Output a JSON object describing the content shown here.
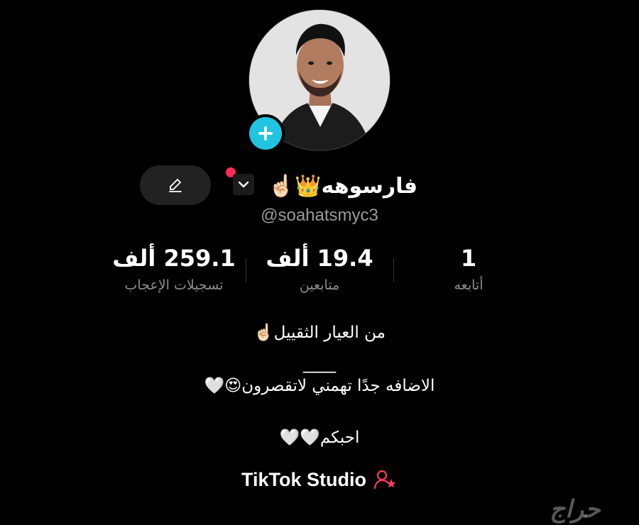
{
  "profile": {
    "display_name": "فارسوهه",
    "name_emojis": "👑☝🏻",
    "handle": "@soahatsmyc3",
    "edit_icon": "pencil-icon",
    "add_icon": "plus-icon",
    "switch_icon": "chevron-down-icon"
  },
  "stats": {
    "likes": {
      "value": "259.1 ألف",
      "label": "تسجيلات الإعجاب"
    },
    "followers": {
      "value": "19.4 ألف",
      "label": "متابعين"
    },
    "following": {
      "value": "1",
      "label": "أتابعه"
    }
  },
  "bio": {
    "line1": "من العيار الثقييل☝🏻",
    "line2": "____",
    "line3": "الاضافه جدًا تهمني لاتقصرون😍🤍",
    "line4": "احبكم🤍🤍"
  },
  "studio": {
    "label": "TikTok Studio",
    "icon": "creator-star-icon"
  },
  "watermark": {
    "text": "حراج"
  },
  "colors": {
    "accent_cyan": "#20c4e0",
    "notification_red": "#ff2d55",
    "studio_icon": "#ff3b5c"
  }
}
